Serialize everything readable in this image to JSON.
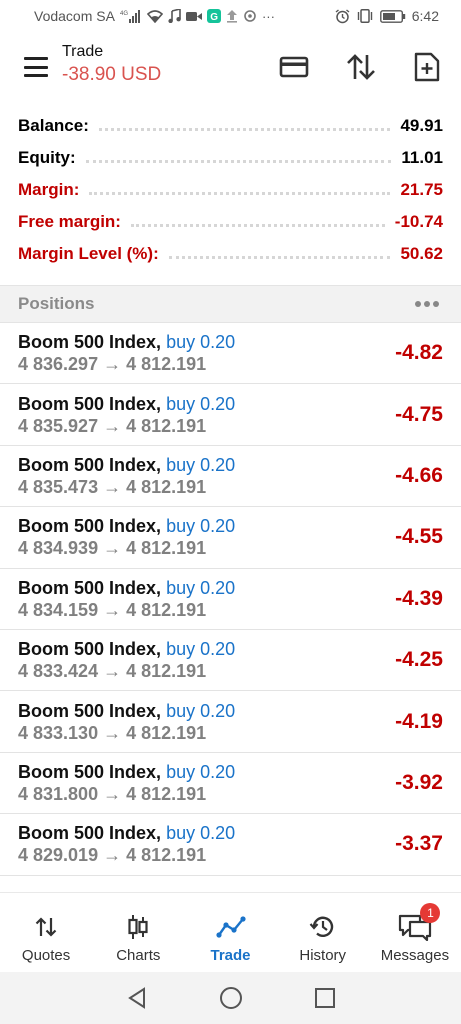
{
  "status_bar": {
    "carrier": "Vodacom SA",
    "network": "4G",
    "time": "6:42",
    "left_icons": [
      "signal-icon",
      "wifi-icon",
      "music-icon",
      "video-icon",
      "grammarly-icon",
      "upload-icon",
      "sync-icon",
      "more-icon"
    ],
    "right_icons": [
      "alarm-icon",
      "vibrate-icon",
      "battery-icon"
    ]
  },
  "header": {
    "title": "Trade",
    "profit": "-38.90 USD",
    "icons": [
      "card-icon",
      "sort-icon",
      "new-order-icon"
    ]
  },
  "summary": [
    {
      "label": "Balance:",
      "value": "49.91",
      "warn": false
    },
    {
      "label": "Equity:",
      "value": "11.01",
      "warn": false
    },
    {
      "label": "Margin:",
      "value": "21.75",
      "warn": true
    },
    {
      "label": "Free margin:",
      "value": "-10.74",
      "warn": true
    },
    {
      "label": "Margin Level (%):",
      "value": "50.62",
      "warn": true
    }
  ],
  "positions": {
    "title": "Positions",
    "items": [
      {
        "symbol": "Boom 500 Index,",
        "side": "buy 0.20",
        "open": "4 836.297",
        "arrow": "→",
        "current": "4 812.191",
        "pl": "-4.82"
      },
      {
        "symbol": "Boom 500 Index,",
        "side": "buy 0.20",
        "open": "4 835.927",
        "arrow": "→",
        "current": "4 812.191",
        "pl": "-4.75"
      },
      {
        "symbol": "Boom 500 Index,",
        "side": "buy 0.20",
        "open": "4 835.473",
        "arrow": "→",
        "current": "4 812.191",
        "pl": "-4.66"
      },
      {
        "symbol": "Boom 500 Index,",
        "side": "buy 0.20",
        "open": "4 834.939",
        "arrow": "→",
        "current": "4 812.191",
        "pl": "-4.55"
      },
      {
        "symbol": "Boom 500 Index,",
        "side": "buy 0.20",
        "open": "4 834.159",
        "arrow": "→",
        "current": "4 812.191",
        "pl": "-4.39"
      },
      {
        "symbol": "Boom 500 Index,",
        "side": "buy 0.20",
        "open": "4 833.424",
        "arrow": "→",
        "current": "4 812.191",
        "pl": "-4.25"
      },
      {
        "symbol": "Boom 500 Index,",
        "side": "buy 0.20",
        "open": "4 833.130",
        "arrow": "→",
        "current": "4 812.191",
        "pl": "-4.19"
      },
      {
        "symbol": "Boom 500 Index,",
        "side": "buy 0.20",
        "open": "4 831.800",
        "arrow": "→",
        "current": "4 812.191",
        "pl": "-3.92"
      },
      {
        "symbol": "Boom 500 Index,",
        "side": "buy 0.20",
        "open": "4 829.019",
        "arrow": "→",
        "current": "4 812.191",
        "pl": "-3.37"
      }
    ]
  },
  "bottom_nav": [
    {
      "label": "Quotes",
      "icon": "quotes-icon",
      "active": false
    },
    {
      "label": "Charts",
      "icon": "charts-icon",
      "active": false
    },
    {
      "label": "Trade",
      "icon": "trade-icon",
      "active": true
    },
    {
      "label": "History",
      "icon": "history-icon",
      "active": false
    },
    {
      "label": "Messages",
      "icon": "messages-icon",
      "active": false,
      "badge": "1"
    }
  ],
  "system_nav": [
    "back-icon",
    "home-icon",
    "recents-icon"
  ],
  "colors": {
    "loss": "#c00000",
    "profit_header": "#d9534f",
    "accent": "#1a73c9"
  }
}
